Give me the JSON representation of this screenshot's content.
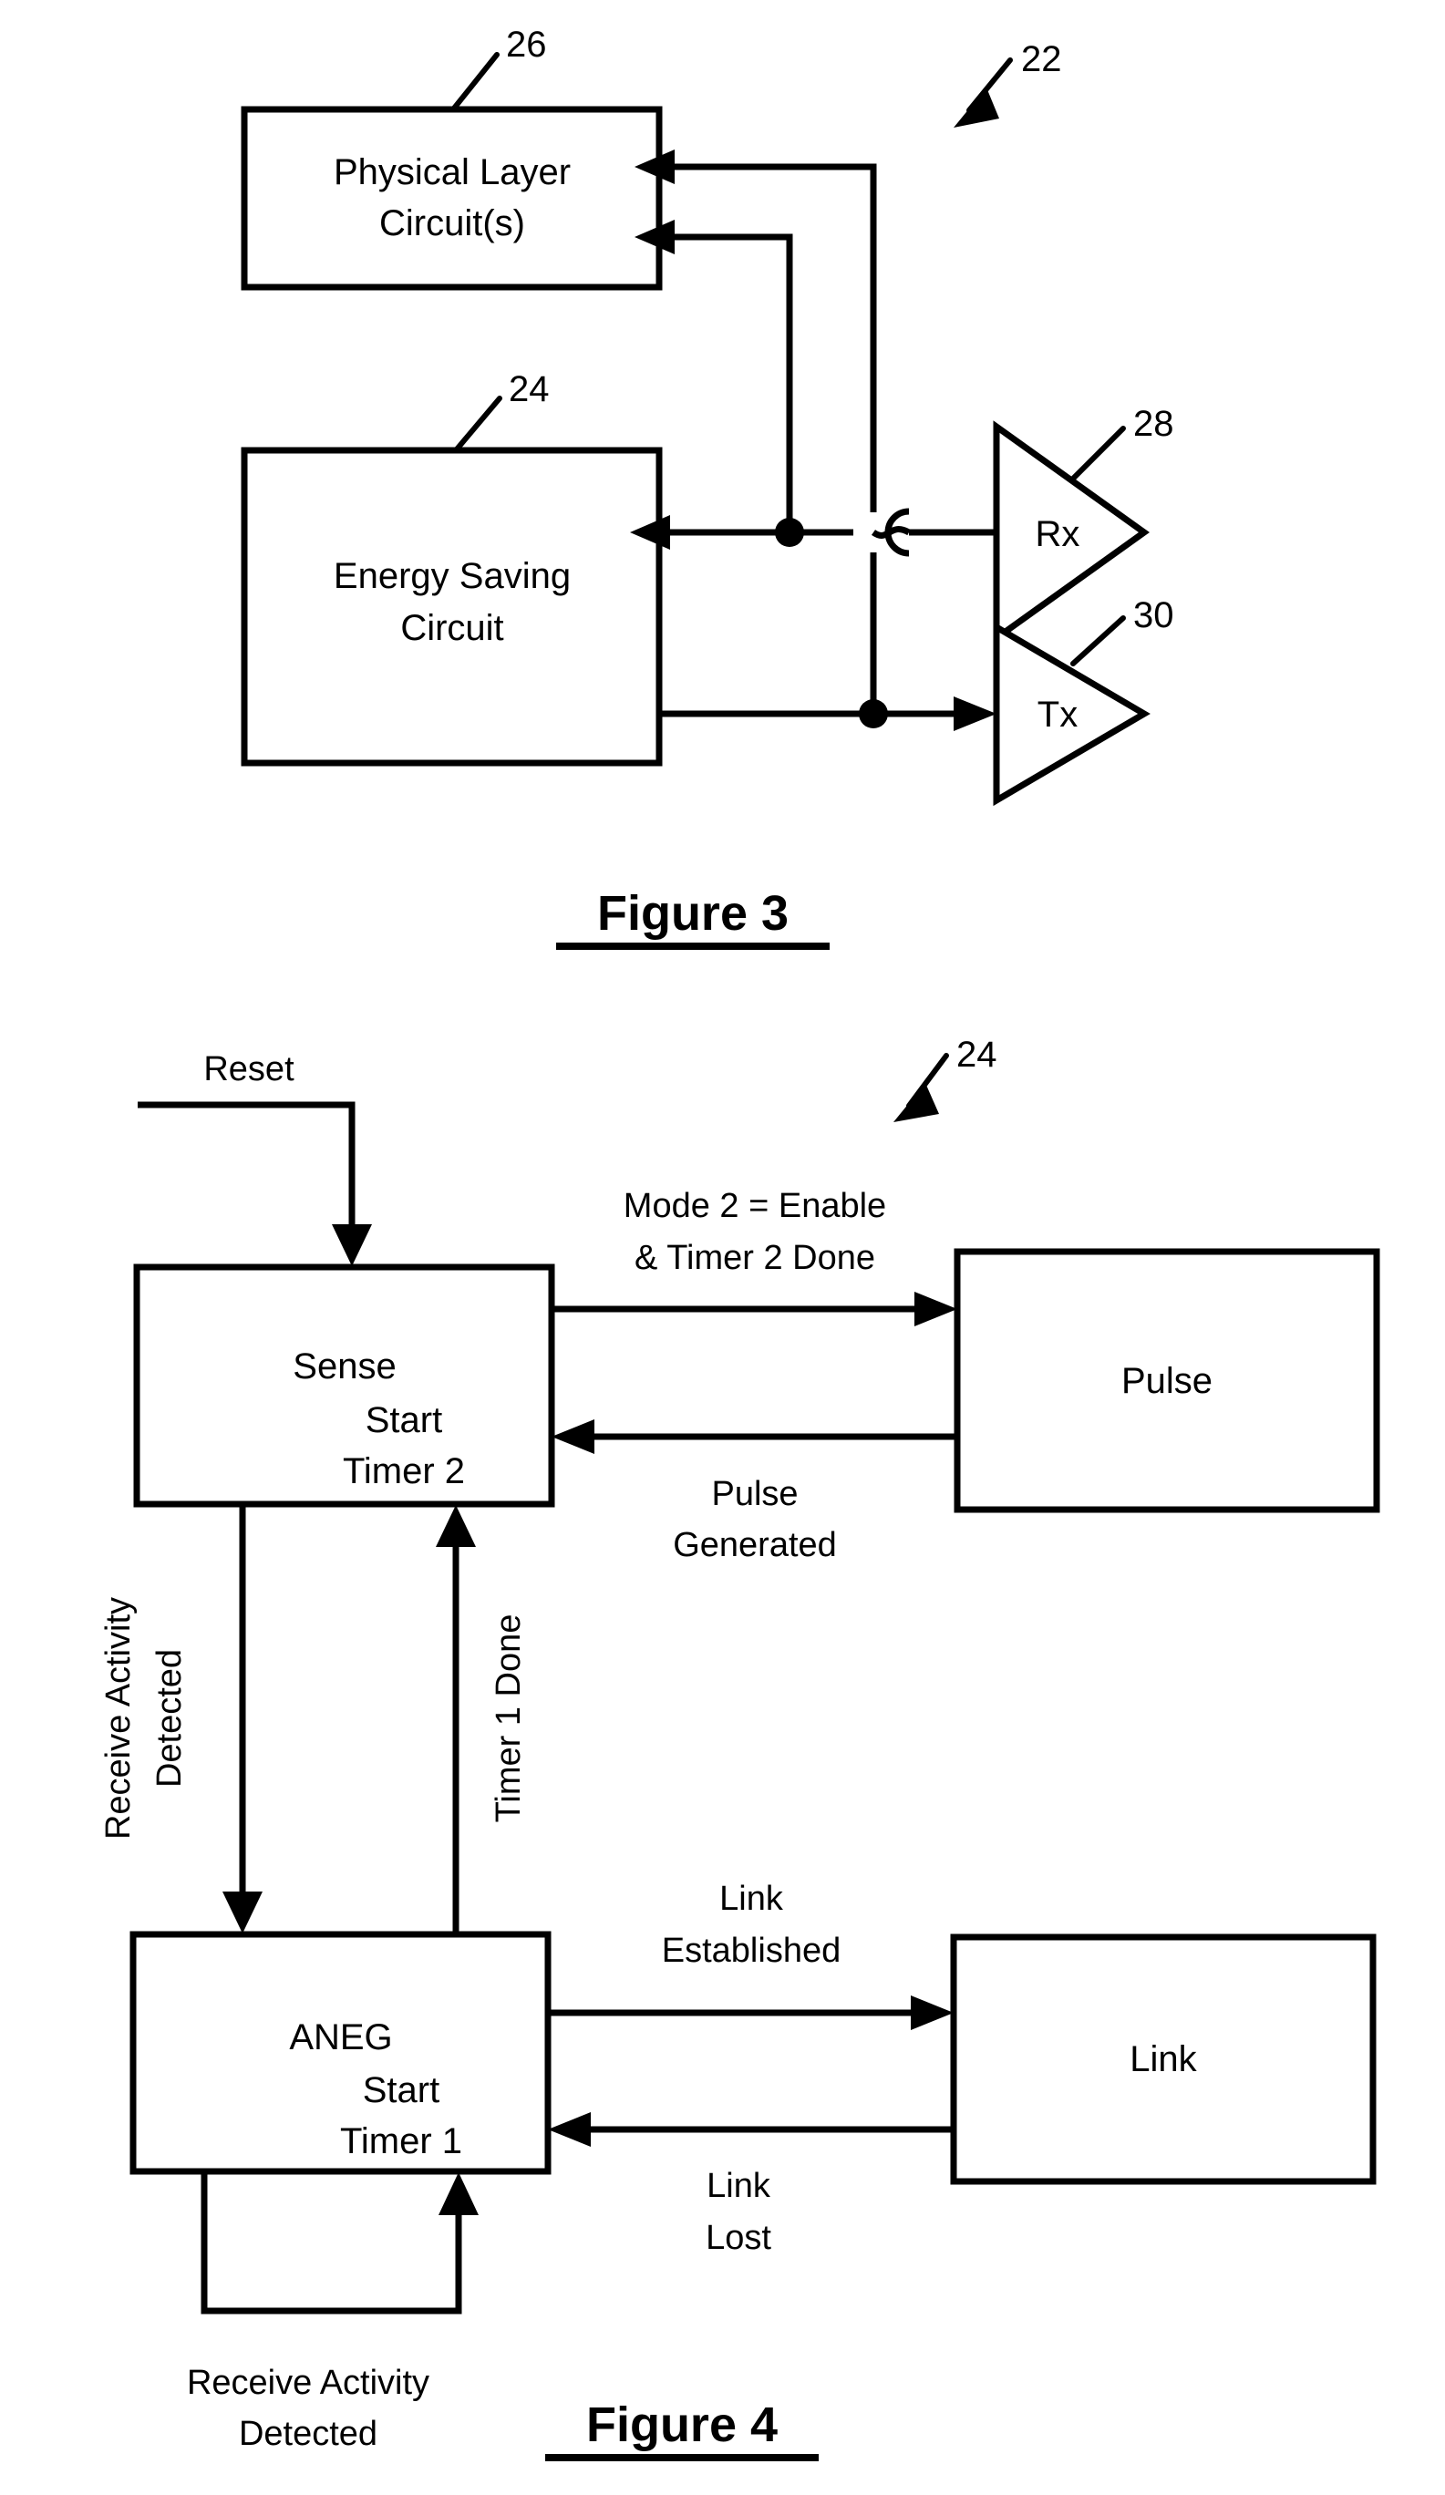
{
  "document": {
    "kind": "patent-drawing-sheet",
    "background_color": "#ffffff",
    "ink_color": "#000000"
  },
  "figure3": {
    "caption": "Figure 3",
    "reference_numerals": {
      "system": "22",
      "physical_layer": "26",
      "energy_saving": "24",
      "rx": "28",
      "tx": "30"
    },
    "blocks": [
      {
        "id": "phy",
        "line1": "Physical Layer",
        "line2": "Circuit(s)",
        "ref": "26"
      },
      {
        "id": "esc",
        "line1": "Energy Saving",
        "line2": "Circuit",
        "ref": "24"
      }
    ],
    "amplifiers": [
      {
        "id": "rx",
        "label": "Rx",
        "ref": "28"
      },
      {
        "id": "tx",
        "label": "Tx",
        "ref": "30"
      }
    ]
  },
  "figure4": {
    "caption": "Figure 4",
    "reference_numerals": {
      "state_machine": "24"
    },
    "states": [
      {
        "id": "sense",
        "title": "Sense",
        "action_line1": "Start",
        "action_line2": "Timer 2"
      },
      {
        "id": "pulse",
        "title": "Pulse",
        "action_line1": "",
        "action_line2": ""
      },
      {
        "id": "aneg",
        "title": "ANEG",
        "action_line1": "Start",
        "action_line2": "Timer 1"
      },
      {
        "id": "link",
        "title": "Link",
        "action_line1": "",
        "action_line2": ""
      }
    ],
    "inputs": [
      {
        "id": "reset",
        "label": "Reset"
      }
    ],
    "transitions": [
      {
        "id": "sense-to-pulse",
        "from": "sense",
        "to": "pulse",
        "line1": "Mode 2 = Enable",
        "line2": "& Timer 2 Done"
      },
      {
        "id": "pulse-to-sense",
        "from": "pulse",
        "to": "sense",
        "line1": "Pulse",
        "line2": "Generated"
      },
      {
        "id": "sense-to-aneg",
        "from": "sense",
        "to": "aneg",
        "line1": "Receive Activity",
        "line2": "Detected",
        "orientation": "vertical-rotated"
      },
      {
        "id": "aneg-to-sense",
        "from": "aneg",
        "to": "sense",
        "line1": "Timer 1 Done",
        "line2": "",
        "orientation": "vertical-rotated"
      },
      {
        "id": "aneg-to-link",
        "from": "aneg",
        "to": "link",
        "line1": "Link",
        "line2": "Established"
      },
      {
        "id": "link-to-aneg",
        "from": "link",
        "to": "aneg",
        "line1": "Link",
        "line2": "Lost"
      },
      {
        "id": "aneg-self",
        "from": "aneg",
        "to": "aneg",
        "line1": "Receive Activity",
        "line2": "Detected"
      }
    ]
  }
}
